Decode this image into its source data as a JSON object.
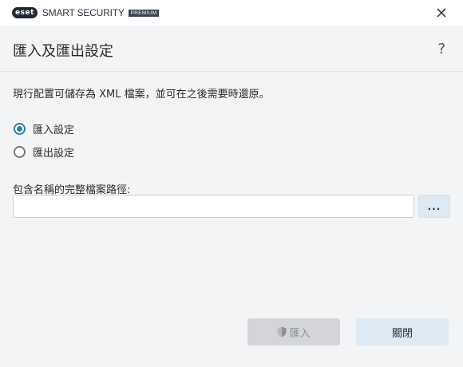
{
  "window": {
    "logo_text": "eset",
    "product_name": "SMART SECURITY",
    "edition": "PREMIUM",
    "close_icon": "close-icon"
  },
  "header": {
    "title": "匯入及匯出設定",
    "help_label": "?"
  },
  "main": {
    "description": "現行配置可儲存為 XML 檔案，並可在之後需要時還原。",
    "options": [
      {
        "label": "匯入設定",
        "selected": true
      },
      {
        "label": "匯出設定",
        "selected": false
      }
    ],
    "path_label": "包含名稱的完整檔案路徑:",
    "path_value": "",
    "browse_label": "..."
  },
  "footer": {
    "import_label": "匯入",
    "import_enabled": false,
    "import_icon": "shield-icon",
    "close_label": "關閉"
  },
  "colors": {
    "accent": "#2d7ea8",
    "button_secondary": "#dde9f3",
    "button_disabled": "#d3d5d8"
  }
}
